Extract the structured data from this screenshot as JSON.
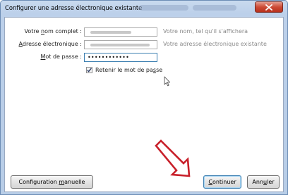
{
  "window": {
    "title": "Configurer une adresse électronique existante"
  },
  "form": {
    "name": {
      "label_pre": "Votre ",
      "label_u": "n",
      "label_post": "om complet :",
      "hint": "Votre nom, tel qu'il s'affichera"
    },
    "email": {
      "label_u": "A",
      "label_post": "dresse électronique :",
      "hint": "Votre adresse électronique existante"
    },
    "password": {
      "label_pre": "",
      "label_u": "M",
      "label_post": "ot de passe :",
      "value_display": "••••••••••••"
    },
    "remember": {
      "checked": true,
      "label_pre": "Retenir le mot de pa",
      "label_u": "s",
      "label_post": "se"
    }
  },
  "buttons": {
    "manual": {
      "pre": "Configuration ",
      "u": "m",
      "post": "anuelle"
    },
    "continue": {
      "pre": "",
      "u": "C",
      "post": "ontinuer"
    },
    "cancel": {
      "pre": "Ann",
      "u": "u",
      "post": "ler"
    }
  },
  "colors": {
    "annotation_arrow": "#c8202a",
    "focus_border": "#3c7fb1"
  }
}
